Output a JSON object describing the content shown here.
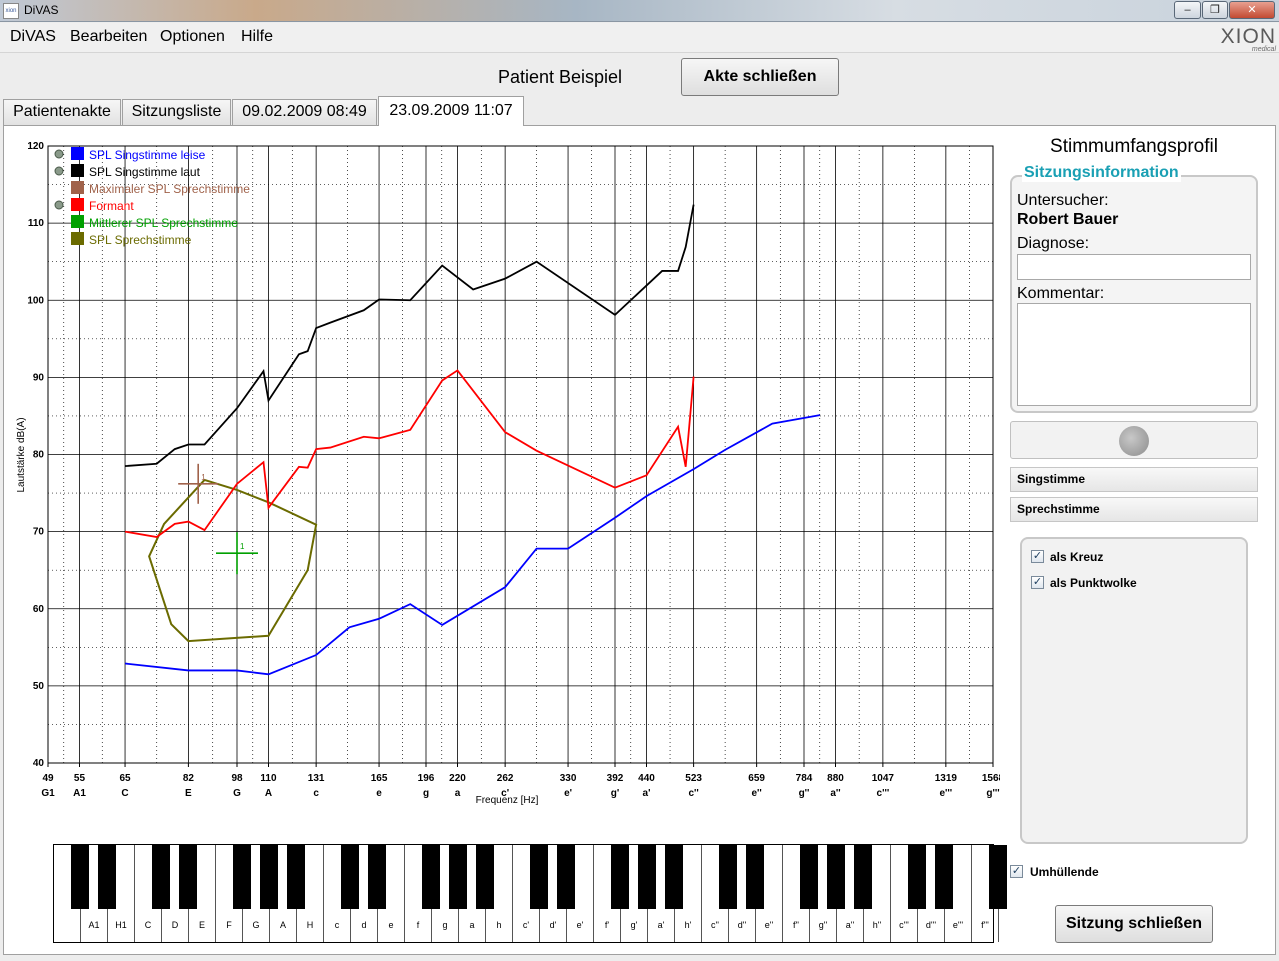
{
  "window": {
    "app_icon": "xion-app-icon",
    "title": "DiVAS",
    "buttons": [
      "minimize",
      "maximize",
      "close"
    ]
  },
  "menu": [
    "DiVAS",
    "Bearbeiten",
    "Optionen",
    "Hilfe"
  ],
  "logo": {
    "main": "XION",
    "sub": "medical"
  },
  "header": {
    "patient": "Patient Beispiel",
    "close_file_button": "Akte schließen"
  },
  "tabs": [
    {
      "label": "Patientenakte",
      "active": false
    },
    {
      "label": "Sitzungsliste",
      "active": false
    },
    {
      "label": "09.02.2009 08:49",
      "active": false
    },
    {
      "label": "23.09.2009 11:07",
      "active": true
    }
  ],
  "chart_data": {
    "type": "line",
    "ylabel": "Lautstärke  dB(A)",
    "xlabel": "Frequenz [Hz]",
    "x_scale": "log",
    "ylim": [
      40,
      120
    ],
    "yticks": [
      40,
      50,
      60,
      70,
      80,
      90,
      100,
      110,
      120
    ],
    "xticks": [
      {
        "hz": 49,
        "note": "G1"
      },
      {
        "hz": 55,
        "note": "A1"
      },
      {
        "hz": 65,
        "note": "C"
      },
      {
        "hz": 82,
        "note": "E"
      },
      {
        "hz": 98,
        "note": "G"
      },
      {
        "hz": 110,
        "note": "A"
      },
      {
        "hz": 131,
        "note": "c"
      },
      {
        "hz": 165,
        "note": "e"
      },
      {
        "hz": 196,
        "note": "g"
      },
      {
        "hz": 220,
        "note": "a"
      },
      {
        "hz": 262,
        "note": "c'"
      },
      {
        "hz": 330,
        "note": "e'"
      },
      {
        "hz": 392,
        "note": "g'"
      },
      {
        "hz": 440,
        "note": "a'"
      },
      {
        "hz": 523,
        "note": "c''"
      },
      {
        "hz": 659,
        "note": "e''"
      },
      {
        "hz": 784,
        "note": "g''"
      },
      {
        "hz": 880,
        "note": "a''"
      },
      {
        "hz": 1047,
        "note": "c'''"
      },
      {
        "hz": 1319,
        "note": "e'''"
      },
      {
        "hz": 1568,
        "note": "g'''"
      }
    ],
    "grid": true,
    "legend_position": "top-left",
    "legend": [
      {
        "name": "SPL Singstimme leise",
        "color": "#0000ff",
        "icon": true
      },
      {
        "name": "SPL Singstimme laut",
        "color": "#000000",
        "icon": true
      },
      {
        "name": "Maximaler SPL Sprechstimme",
        "color": "#a0624a",
        "icon": false
      },
      {
        "name": "Formant",
        "color": "#ff0000",
        "icon": true
      },
      {
        "name": "Mittlerer SPL Sprechstimme",
        "color": "#00a000",
        "icon": false
      },
      {
        "name": "SPL Sprechstimme",
        "color": "#6b6b00",
        "icon": false
      }
    ],
    "series": [
      {
        "name": "SPL Singstimme leise",
        "color": "#0000ff",
        "points": [
          [
            65,
            52.9
          ],
          [
            82,
            52
          ],
          [
            98,
            52
          ],
          [
            110,
            51.5
          ],
          [
            131,
            54
          ],
          [
            148,
            57.6
          ],
          [
            165,
            58.7
          ],
          [
            185,
            60.6
          ],
          [
            208,
            57.9
          ],
          [
            262,
            62.8
          ],
          [
            294,
            67.8
          ],
          [
            330,
            67.8
          ],
          [
            392,
            71.8
          ],
          [
            440,
            74.6
          ],
          [
            523,
            78.1
          ],
          [
            587,
            80.6
          ],
          [
            698,
            84
          ],
          [
            831,
            85.1
          ]
        ]
      },
      {
        "name": "SPL Singstimme laut",
        "color": "#000000",
        "points": [
          [
            65,
            78.5
          ],
          [
            73,
            78.8
          ],
          [
            78,
            80.7
          ],
          [
            82,
            81.3
          ],
          [
            87,
            81.3
          ],
          [
            98,
            86
          ],
          [
            108,
            90.8
          ],
          [
            110,
            87
          ],
          [
            123,
            93
          ],
          [
            127,
            93.4
          ],
          [
            131,
            96.4
          ],
          [
            138,
            97.1
          ],
          [
            156,
            98.7
          ],
          [
            165,
            100.1
          ],
          [
            185,
            100
          ],
          [
            208,
            104.5
          ],
          [
            233,
            101.4
          ],
          [
            262,
            102.8
          ],
          [
            294,
            105
          ],
          [
            392,
            98.1
          ],
          [
            466,
            103.8
          ],
          [
            494,
            103.8
          ],
          [
            508,
            106.9
          ],
          [
            523,
            112.4
          ]
        ]
      },
      {
        "name": "Formant",
        "color": "#ff0000",
        "points": [
          [
            65,
            70
          ],
          [
            73,
            69.3
          ],
          [
            78,
            71
          ],
          [
            82,
            71.3
          ],
          [
            87,
            70.2
          ],
          [
            98,
            76.2
          ],
          [
            108,
            79
          ],
          [
            110,
            73.1
          ],
          [
            123,
            78.4
          ],
          [
            127,
            78.3
          ],
          [
            131,
            80.7
          ],
          [
            138,
            80.9
          ],
          [
            156,
            82.3
          ],
          [
            165,
            82.1
          ],
          [
            185,
            83.2
          ],
          [
            208,
            89.6
          ],
          [
            220,
            90.9
          ],
          [
            262,
            82.9
          ],
          [
            294,
            80.5
          ],
          [
            392,
            75.7
          ],
          [
            440,
            77.3
          ],
          [
            494,
            83.6
          ],
          [
            508,
            78.4
          ],
          [
            523,
            90.1
          ]
        ]
      }
    ],
    "sprechstimme_area": {
      "name": "SPL Sprechstimme",
      "color": "#6b6b00",
      "points": [
        [
          87,
          76.7
        ],
        [
          98,
          75.4
        ],
        [
          110,
          73.8
        ],
        [
          131,
          70.9
        ],
        [
          127,
          65
        ],
        [
          110,
          56.5
        ],
        [
          82,
          55.8
        ],
        [
          77,
          58
        ],
        [
          71,
          66.8
        ],
        [
          75,
          71
        ]
      ]
    },
    "markers": [
      {
        "name": "Maximaler SPL Sprechstimme",
        "type": "cross",
        "hz": 85,
        "db": 76.2,
        "color": "#a0624a",
        "label": "1"
      },
      {
        "name": "Mittlerer SPL Sprechstimme",
        "type": "cross",
        "hz": 98,
        "db": 67.2,
        "color": "#00a000",
        "label": "1"
      }
    ]
  },
  "piano": {
    "labels": [
      "",
      "A1",
      "H1",
      "C",
      "D",
      "E",
      "F",
      "G",
      "A",
      "H",
      "c",
      "d",
      "e",
      "f",
      "g",
      "a",
      "h",
      "c'",
      "d'",
      "e'",
      "f'",
      "g'",
      "a'",
      "h'",
      "c''",
      "d''",
      "e''",
      "f''",
      "g''",
      "a''",
      "h''",
      "c'''",
      "d'''",
      "e'''",
      "f'''",
      ""
    ]
  },
  "right_panel": {
    "title": "Stimmumfangsprofil",
    "section_title": "Sitzungsinformation",
    "examiner_label": "Untersucher:",
    "examiner": "Robert Bauer",
    "diagnosis_label": "Diagnose:",
    "diagnosis_value": "",
    "comment_label": "Kommentar:",
    "comment_value": "",
    "bars": [
      "Singstimme",
      "Sprechstimme"
    ],
    "options": [
      {
        "label": "als Kreuz",
        "checked": true
      },
      {
        "label": "als Punktwolke",
        "checked": true
      }
    ],
    "envelope": {
      "label": "Umhüllende",
      "checked": true
    },
    "close_session_button": "Sitzung schließen"
  }
}
